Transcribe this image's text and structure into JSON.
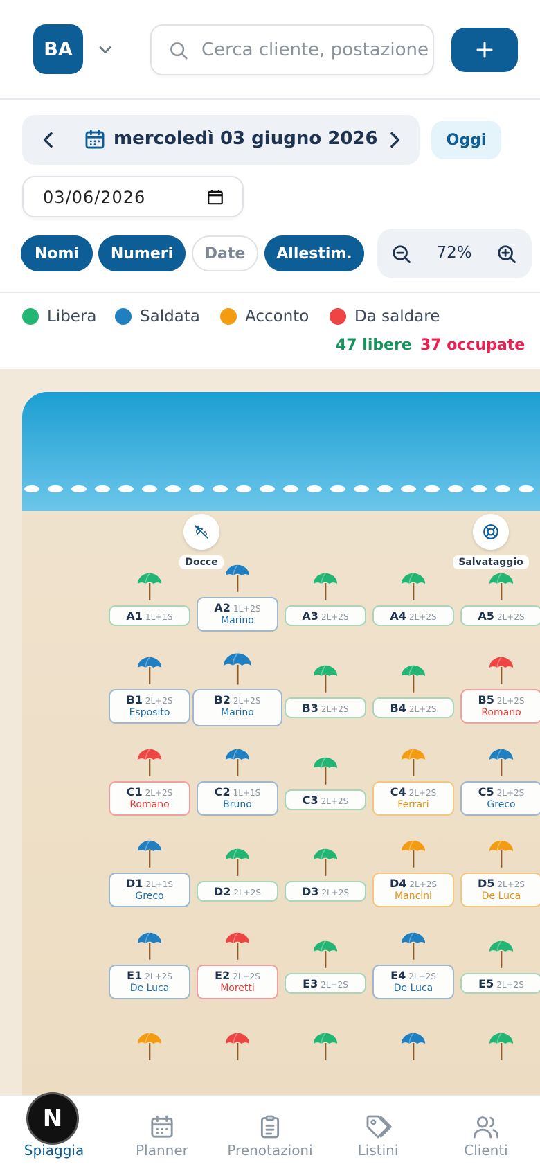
{
  "header": {
    "avatar_initials": "BA",
    "search_placeholder": "Cerca cliente, postazione..."
  },
  "datebar": {
    "date_label": "mercoledì 03 giugno 2026",
    "today_label": "Oggi",
    "date_input_value": "03/06/2026"
  },
  "filters": {
    "chips": [
      {
        "label": "Nomi",
        "active": true
      },
      {
        "label": "Numeri",
        "active": true
      },
      {
        "label": "Date",
        "active": false
      },
      {
        "label": "Allestim.",
        "active": true
      }
    ],
    "zoom_label": "72%"
  },
  "legend": {
    "items": [
      {
        "label": "Libera",
        "color": "#22b573"
      },
      {
        "label": "Saldata",
        "color": "#1f7fc0"
      },
      {
        "label": "Acconto",
        "color": "#f39c12"
      },
      {
        "label": "Da saldare",
        "color": "#ef4444"
      }
    ],
    "free_count": "47 libere",
    "occupied_count": "37 occupate"
  },
  "facilities": [
    {
      "label": "Docce",
      "icon": "shower-icon"
    },
    {
      "label": "Salvataggio",
      "icon": "lifebuoy-icon"
    }
  ],
  "colors": {
    "free": "#22b573",
    "paid": "#1f7fc0",
    "deposit": "#f39c12",
    "unpaid": "#ef4444"
  },
  "rows": [
    [
      {
        "code": "A1",
        "conf": "1L+1S",
        "status": "free",
        "name": ""
      },
      {
        "code": "A2",
        "conf": "1L+2S",
        "status": "paid",
        "name": "Marino"
      },
      {
        "code": "A3",
        "conf": "2L+2S",
        "status": "free",
        "name": ""
      },
      {
        "code": "A4",
        "conf": "2L+2S",
        "status": "free",
        "name": ""
      },
      {
        "code": "A5",
        "conf": "2L+2S",
        "status": "free",
        "name": ""
      }
    ],
    [
      {
        "code": "B1",
        "conf": "2L+2S",
        "status": "paid",
        "name": "Esposito"
      },
      {
        "code": "B2",
        "conf": "2L+2S",
        "status": "paid",
        "name": "Marino",
        "big": true
      },
      {
        "code": "B3",
        "conf": "2L+2S",
        "status": "free",
        "name": ""
      },
      {
        "code": "B4",
        "conf": "2L+2S",
        "status": "free",
        "name": ""
      },
      {
        "code": "B5",
        "conf": "2L+2S",
        "status": "unpaid",
        "name": "Romano"
      }
    ],
    [
      {
        "code": "C1",
        "conf": "2L+2S",
        "status": "unpaid",
        "name": "Romano"
      },
      {
        "code": "C2",
        "conf": "1L+1S",
        "status": "paid",
        "name": "Bruno"
      },
      {
        "code": "C3",
        "conf": "2L+2S",
        "status": "free",
        "name": ""
      },
      {
        "code": "C4",
        "conf": "2L+2S",
        "status": "deposit",
        "name": "Ferrari"
      },
      {
        "code": "C5",
        "conf": "2L+2S",
        "status": "paid",
        "name": "Greco"
      }
    ],
    [
      {
        "code": "D1",
        "conf": "2L+1S",
        "status": "paid",
        "name": "Greco"
      },
      {
        "code": "D2",
        "conf": "2L+2S",
        "status": "free",
        "name": ""
      },
      {
        "code": "D3",
        "conf": "2L+2S",
        "status": "free",
        "name": ""
      },
      {
        "code": "D4",
        "conf": "2L+2S",
        "status": "deposit",
        "name": "Mancini"
      },
      {
        "code": "D5",
        "conf": "2L+2S",
        "status": "deposit",
        "name": "De Luca"
      }
    ],
    [
      {
        "code": "E1",
        "conf": "2L+2S",
        "status": "paid",
        "name": "De Luca"
      },
      {
        "code": "E2",
        "conf": "2L+2S",
        "status": "unpaid",
        "name": "Moretti"
      },
      {
        "code": "E3",
        "conf": "2L+2S",
        "status": "free",
        "name": ""
      },
      {
        "code": "E4",
        "conf": "2L+2S",
        "status": "paid",
        "name": "De Luca"
      },
      {
        "code": "E5",
        "conf": "2L+2S",
        "status": "free",
        "name": ""
      }
    ],
    [
      {
        "code": "",
        "conf": "",
        "status": "deposit",
        "name": ""
      },
      {
        "code": "",
        "conf": "",
        "status": "unpaid",
        "name": ""
      },
      {
        "code": "",
        "conf": "",
        "status": "free",
        "name": ""
      },
      {
        "code": "",
        "conf": "",
        "status": "paid",
        "name": ""
      },
      {
        "code": "",
        "conf": "",
        "status": "free",
        "name": ""
      }
    ]
  ],
  "nav": {
    "items": [
      {
        "label": "Spiaggia",
        "icon": "beach-icon",
        "active": true
      },
      {
        "label": "Planner",
        "icon": "calendar-icon",
        "active": false
      },
      {
        "label": "Prenotazioni",
        "icon": "clipboard-icon",
        "active": false
      },
      {
        "label": "Listini",
        "icon": "tag-icon",
        "active": false
      },
      {
        "label": "Clienti",
        "icon": "users-icon",
        "active": false
      }
    ],
    "badge_letter": "N"
  }
}
